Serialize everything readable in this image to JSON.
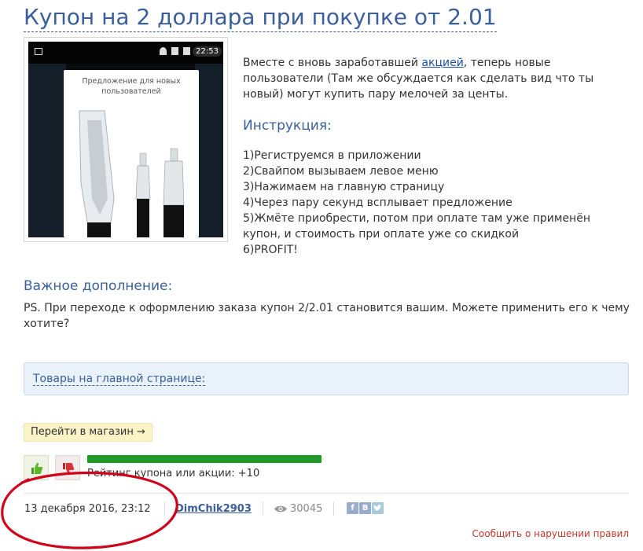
{
  "post": {
    "title": "Купон на 2 доллара при покупке от 2.01",
    "image": {
      "caption": "Предложение для новых пользователей",
      "clock": "22:53"
    },
    "intro_before": "Вместе с вновь заработавшей ",
    "intro_link": "акцией",
    "intro_after": ", теперь новые пользователи (Там же обсуждается как сделать вид что ты новый) могут купить пару мелочей за центы.",
    "instruction_title": "Инструкция:",
    "steps": [
      "1)Региструемся в приложении",
      "2)Свайпом вызываем левое меню",
      "3)Нажимаем на главную страницу",
      "4)Через пару секунд всплывает предложение",
      "5)Жмёте приобрести, потом при оплате там уже применён купон, и стоимость при оплате уже со скидкой",
      "6)PROFIT!"
    ],
    "important_title": "Важное дополнение:",
    "ps_text": "PS. При переходе к оформлению заказа купон 2/2.01 становится вашим. Можете применить его к чему хотите?",
    "products_box": "Товары на главной странице:"
  },
  "actions": {
    "shop_button": "Перейти в магазин →"
  },
  "rating": {
    "text": "Рейтинг купона или акции: +10",
    "fill_fraction": 1.0
  },
  "meta": {
    "date": "13 декабря 2016, 23:12",
    "author": "DimChik2903",
    "views": "30045",
    "share": {
      "fb": "f",
      "vk": "B"
    },
    "report": "Сообщить о нарушении правил"
  },
  "colors": {
    "accent": "#3a5f9a",
    "rating_green": "#1e9a24",
    "annotation_red": "#d0021b"
  }
}
